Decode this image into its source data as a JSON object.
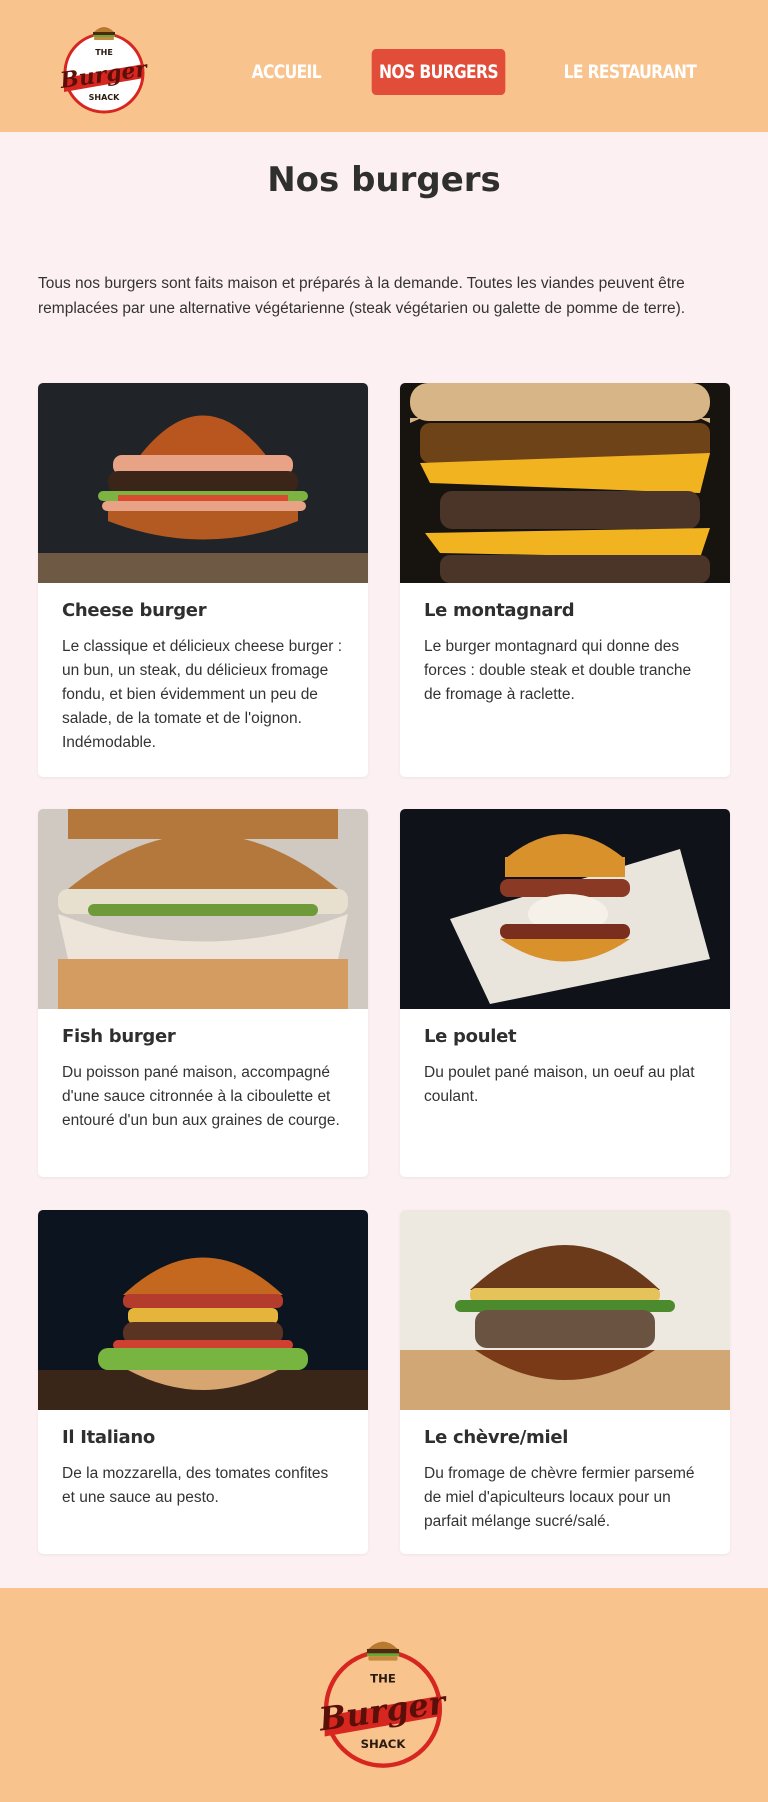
{
  "brand": {
    "logo_top": "THE",
    "logo_main": "Burger",
    "logo_bottom": "SHACK",
    "colors": {
      "header_bg": "#f9c38e",
      "accent": "#e24d3a",
      "logo_red": "#d7261f",
      "page_bg": "#fdf0f3"
    }
  },
  "nav": {
    "items": [
      {
        "label": "ACCUEIL",
        "active": false
      },
      {
        "label": "NOS BURGERS",
        "active": true
      },
      {
        "label": "LE RESTAURANT",
        "active": false
      }
    ]
  },
  "main": {
    "title": "Nos burgers",
    "intro": "Tous nos burgers sont faits maison et préparés à la demande. Toutes les viandes peuvent être remplacées par une alternative végétarienne (steak végétarien ou galette de pomme de terre).",
    "burgers": [
      {
        "name": "Cheese burger",
        "description": "Le classique et délicieux cheese burger : un bun, un steak, du délicieux fromage fondu, et bien évidemment un peu de salade, de la tomate et de l'oignon. Indémodable."
      },
      {
        "name": "Le montagnard",
        "description": "Le burger montagnard qui donne des forces : double steak et double tranche de fromage à raclette."
      },
      {
        "name": "Fish burger",
        "description": "Du poisson pané maison, accompagné d'une sauce citronnée à la ciboulette et entouré d'un bun aux graines de courge."
      },
      {
        "name": "Le poulet",
        "description": "Du poulet pané maison, un oeuf au plat coulant."
      },
      {
        "name": "Il Italiano",
        "description": "De la mozzarella, des tomates confites et une sauce au pesto."
      },
      {
        "name": "Le chèvre/miel",
        "description": "Du fromage de chèvre fermier parsemé de miel d'apiculteurs locaux pour un parfait mélange sucré/salé."
      }
    ]
  }
}
